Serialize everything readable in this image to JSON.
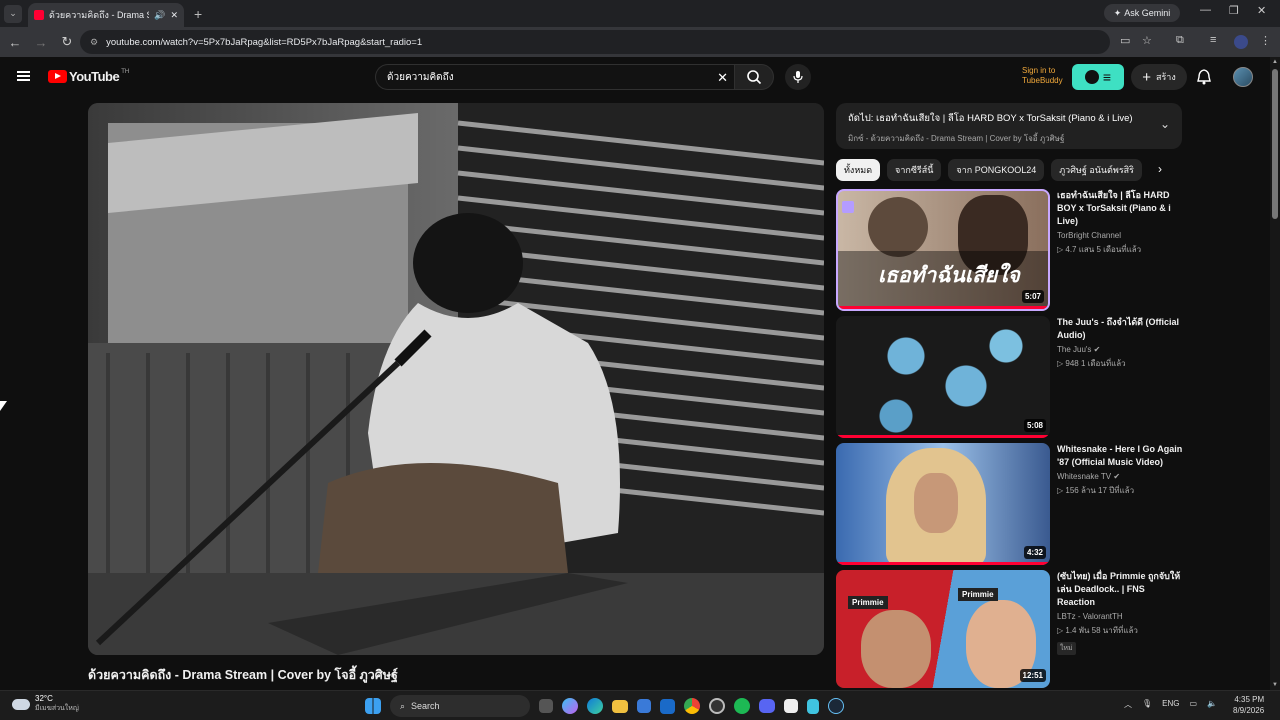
{
  "browser": {
    "tab_title": "ด้วยความคิดถึง - Drama Stream",
    "address": "youtube.com/watch?v=5Px7bJaRpag&list=RD5Px7bJaRpag&start_radio=1",
    "gemini_label": "Ask Gemini"
  },
  "header": {
    "logo_text": "YouTube",
    "logo_suffix": "TH",
    "search_value": "ด้วยความคิดถึง",
    "tubebuddy_line1": "Sign in to",
    "tubebuddy_line2": "TubeBuddy",
    "create_label": "สร้าง"
  },
  "video": {
    "title": "ด้วยความคิดถึง - Drama Stream | Cover by โจอี้ ภูวศิษฐ์"
  },
  "playlist": {
    "title": "ถัดไป: เธอทำฉันเสียใจ | ลีโอ HARD BOY x TorSaksit (Piano & i Live)",
    "subtitle": "มิกซ์ - ด้วยความคิดถึง - Drama Stream | Cover by โจอี้ ภูวศิษฐ์"
  },
  "chips": [
    "ทั้งหมด",
    "จากซีรีส์นี้",
    "จาก PONGKOOL24",
    "ภูวศิษฐ์ อนันต์พรสิริ"
  ],
  "recommendations": [
    {
      "title": "เธอทำฉันเสียใจ | ลีโอ HARD BOY x TorSaksit (Piano & i Live)",
      "channel": "TorBright Channel",
      "meta": "▷ 4.7 แสน  5 เดือนที่แล้ว",
      "duration": "5:07",
      "thumb_text": "เธอทำฉันเสียใจ"
    },
    {
      "title": "The Juu's - ถึงจำได้ดี (Official Audio)",
      "channel": "The Juu's ✔",
      "meta": "▷ 948  1 เดือนที่แล้ว",
      "duration": "5:08"
    },
    {
      "title": "Whitesnake - Here I Go Again '87 (Official Music Video)",
      "channel": "Whitesnake TV ✔",
      "meta": "▷ 156 ล้าน  17 ปีที่แล้ว",
      "duration": "4:32"
    },
    {
      "title": "(ซับไทย) เมื่อ Primmie ถูกจับให้เล่น Deadlock.. | FNS Reaction",
      "channel": "LBTz - ValorantTH",
      "meta": "▷ 1.4 พัน  58 นาทีที่แล้ว",
      "duration": "12:51",
      "badge": "ใหม่",
      "thumb_label": "Primmie"
    }
  ],
  "taskbar": {
    "temp": "32°C",
    "weather": "มีเมฆส่วนใหญ่",
    "search_label": "Search",
    "lang": "ENG",
    "time": "4:35 PM",
    "date": "8/9/2026"
  }
}
